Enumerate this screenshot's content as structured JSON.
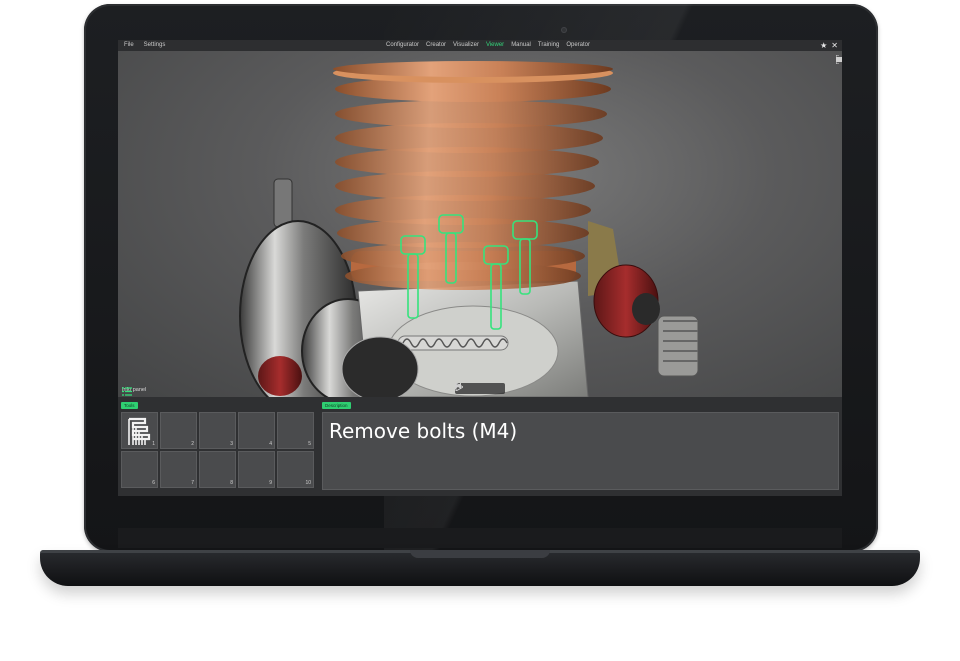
{
  "menubar": {
    "left": [
      "File",
      "Settings"
    ],
    "tabs": [
      "Configurator",
      "Creator",
      "Visualizer",
      "Viewer",
      "Manual",
      "Training",
      "Operator"
    ],
    "active_tab": "Viewer",
    "right_icons": [
      "star-icon",
      "close-icon"
    ]
  },
  "viewport": {
    "tool_icons": [
      "camera-icon",
      "focus-frame-icon"
    ],
    "info_panel_label": "Info panel",
    "playback_icons": [
      "skip-back-icon",
      "play-icon",
      "skip-forward-icon"
    ],
    "highlight_color": "#35e37d"
  },
  "tools_panel": {
    "header": "Tools",
    "slots": [
      "1",
      "2",
      "3",
      "4",
      "5",
      "6",
      "7",
      "8",
      "9",
      "10"
    ],
    "slot1_icon": "hex-key-set-icon"
  },
  "description_panel": {
    "header": "Description",
    "text": "Remove bolts (M4)"
  },
  "colors": {
    "accent_green": "#2fcf72",
    "panel_bg": "#2f3032",
    "slot_bg": "#4a4b4d"
  }
}
